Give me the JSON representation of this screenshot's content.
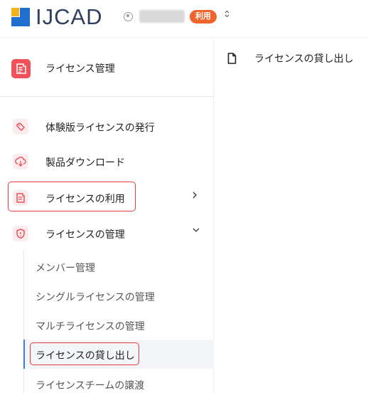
{
  "header": {
    "logo_text": "IJCAD",
    "user_icon": "user-circle-icon",
    "badge": "利用",
    "switch_icon": "updown-chevron-icon",
    "badge_color": "#f0642b"
  },
  "sidebar": {
    "top_item": {
      "label": "ライセンス管理",
      "icon": "license-document-icon",
      "icon_color": "#f1525a"
    },
    "items": [
      {
        "label": "体験版ライセンスの発行",
        "icon": "tag-icon"
      },
      {
        "label": "製品ダウンロード",
        "icon": "cloud-download-icon"
      },
      {
        "label": "ライセンスの利用",
        "icon": "license-document-icon",
        "chevron": "›",
        "highlighted": true
      },
      {
        "label": "ライセンスの管理",
        "icon": "shield-icon",
        "chevron": "⌄",
        "expanded": true
      }
    ],
    "sub_items": [
      {
        "label": "メンバー管理"
      },
      {
        "label": "シングルライセンスの管理"
      },
      {
        "label": "マルチライセンスの管理"
      },
      {
        "label": "ライセンスの貸し出し",
        "active": true,
        "highlighted": true
      },
      {
        "label": "ライセンスチームの譲渡"
      }
    ]
  },
  "main": {
    "title": "ライセンスの貸し出し",
    "title_icon": "document-icon"
  },
  "colors": {
    "accent": "#3c7bf0",
    "highlight_border": "#e23b3b",
    "icon_bg": "#fdeced"
  }
}
